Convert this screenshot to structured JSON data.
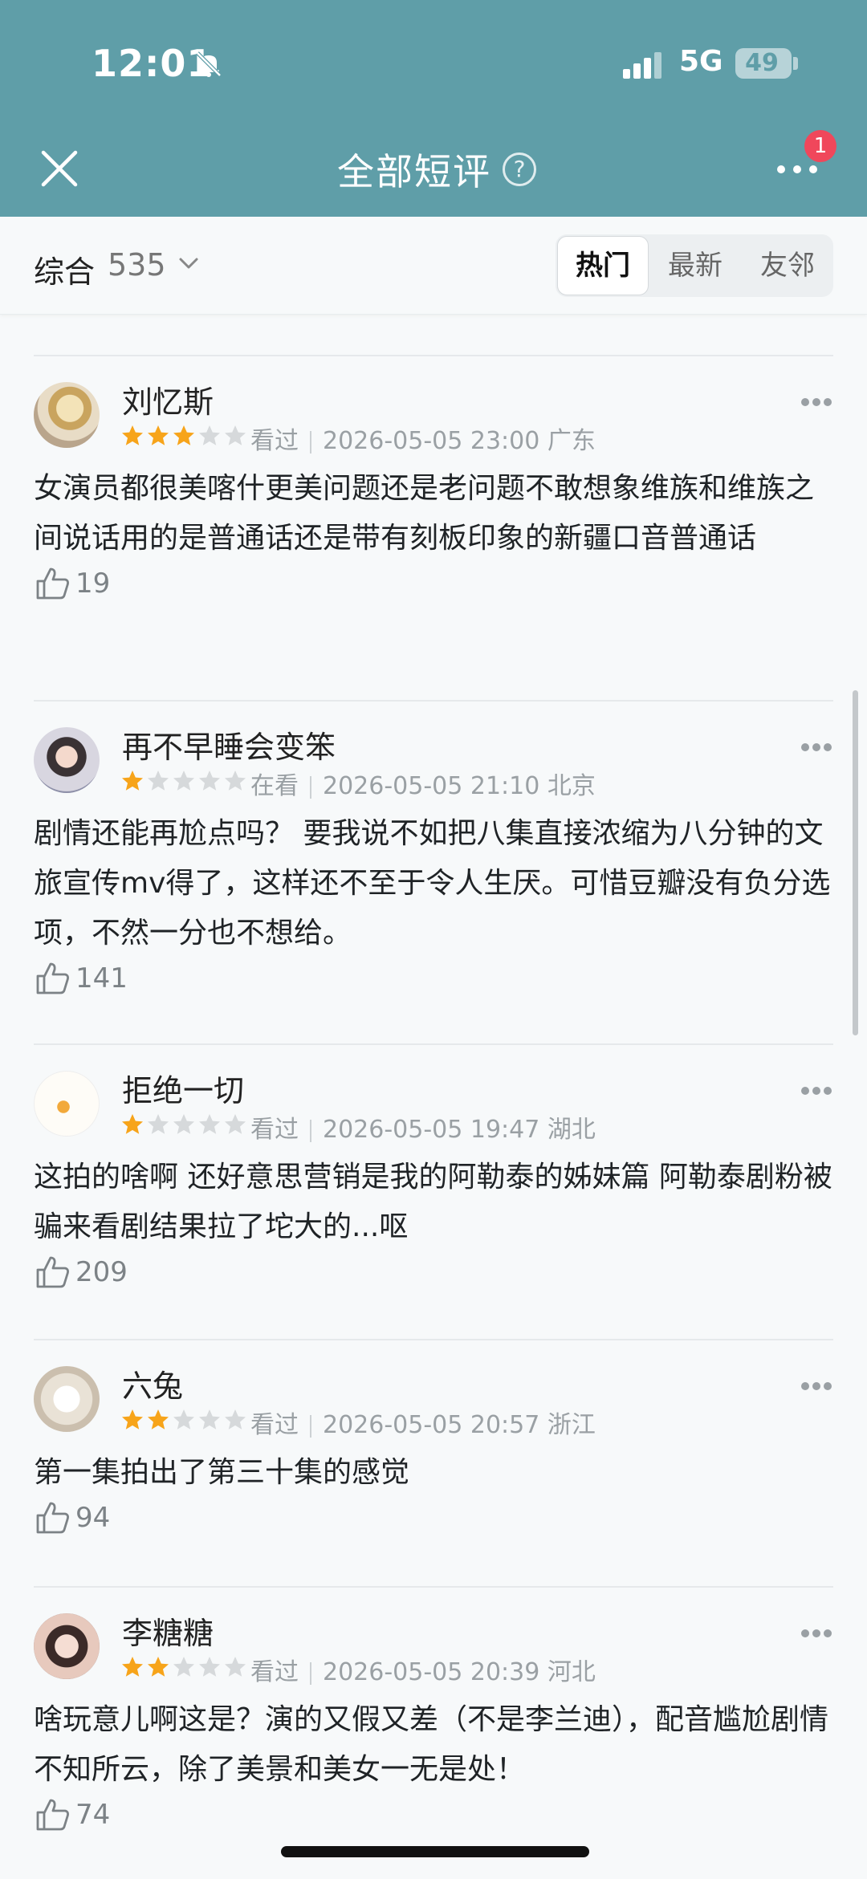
{
  "status": {
    "time": "12:01",
    "network": "5G",
    "battery": "49"
  },
  "nav": {
    "title": "全部短评",
    "help_symbol": "?",
    "badge_count": "1"
  },
  "filter": {
    "sort_label": "综合",
    "count": "535",
    "tabs": [
      {
        "label": "热门",
        "active": true
      },
      {
        "label": "最新",
        "active": false
      },
      {
        "label": "友邻",
        "active": false
      }
    ]
  },
  "colors": {
    "header": "#5f9ea8",
    "star_on": "#f7a41a",
    "star_off": "#d6d9db",
    "badge": "#f0475b"
  },
  "comments": [
    {
      "user": "刘忆斯",
      "rating": 3,
      "status": "看过",
      "datetime": "2026-05-05 23:00",
      "location": "广东",
      "text": "女演员都很美喀什更美问题还是老问题不敢想象维族和维族之间说话用的是普通话还是带有刻板印象的新疆口音普通话",
      "likes": "19"
    },
    {
      "user": "再不早睡会变笨",
      "rating": 1,
      "status": "在看",
      "datetime": "2026-05-05 21:10",
      "location": "北京",
      "text": "剧情还能再尬点吗？ 要我说不如把八集直接浓缩为八分钟的文旅宣传mv得了，这样还不至于令人生厌。可惜豆瓣没有负分选项，不然一分也不想给。",
      "likes": "141"
    },
    {
      "user": "拒绝一切",
      "rating": 1,
      "status": "看过",
      "datetime": "2026-05-05 19:47",
      "location": "湖北",
      "text": "这拍的啥啊 还好意思营销是我的阿勒泰的姊妹篇 阿勒泰剧粉被骗来看剧结果拉了坨大的...呕",
      "likes": "209"
    },
    {
      "user": "六兔",
      "rating": 2,
      "status": "看过",
      "datetime": "2026-05-05 20:57",
      "location": "浙江",
      "text": "第一集拍出了第三十集的感觉",
      "likes": "94"
    },
    {
      "user": "李糖糖",
      "rating": 2,
      "status": "看过",
      "datetime": "2026-05-05 20:39",
      "location": "河北",
      "text": "啥玩意儿啊这是？演的又假又差（不是李兰迪），配音尴尬剧情不知所云，除了美景和美女一无是处！",
      "likes": "74"
    }
  ]
}
